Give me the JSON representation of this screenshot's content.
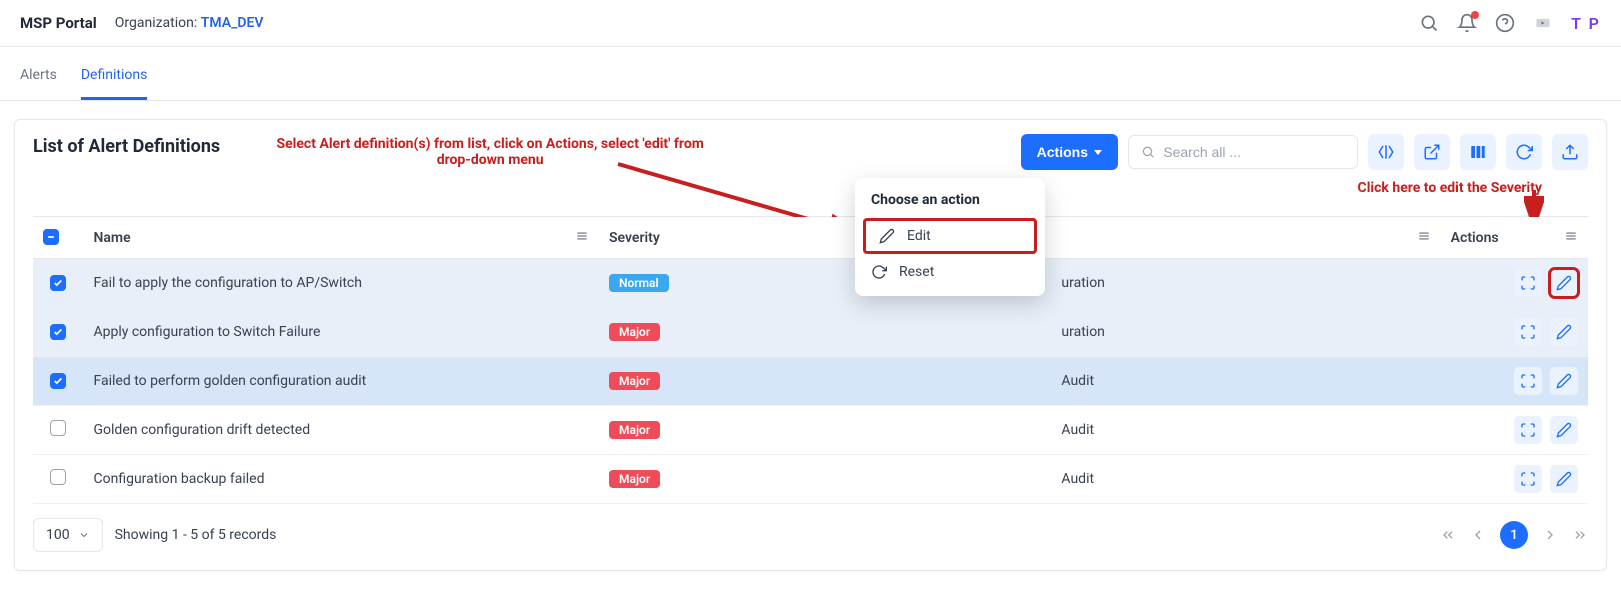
{
  "header": {
    "brand": "MSP Portal",
    "org_label": "Organization:",
    "org_name": "TMA_DEV",
    "avatar": "T P"
  },
  "tabs": [
    {
      "label": "Alerts",
      "active": false
    },
    {
      "label": "Definitions",
      "active": true
    }
  ],
  "page": {
    "title": "List of Alert Definitions",
    "annotation1": "Select Alert definition(s) from list, click on Actions, select 'edit' from drop-down menu",
    "annotation2": "Click here to edit the Severity",
    "actions_btn": "Actions",
    "search_placeholder": "Search all ..."
  },
  "actions_menu": {
    "title": "Choose an action",
    "items": [
      {
        "label": "Edit",
        "icon": "pencil",
        "highlight": true
      },
      {
        "label": "Reset",
        "icon": "reset",
        "highlight": false
      }
    ]
  },
  "table": {
    "columns": {
      "name": "Name",
      "severity": "Severity",
      "actions": "Actions"
    },
    "hidden_col_value_suffix": "uration",
    "rows": [
      {
        "checked": true,
        "name": "Fail to apply the configuration to AP/Switch",
        "severity": "Normal",
        "sev_class": "normal",
        "category": "uration",
        "selected": true,
        "highlightEdit": true
      },
      {
        "checked": true,
        "name": "Apply configuration to Switch Failure",
        "severity": "Major",
        "sev_class": "major",
        "category": "uration",
        "selected": true,
        "highlightEdit": false
      },
      {
        "checked": true,
        "name": "Failed to perform golden configuration audit",
        "severity": "Major",
        "sev_class": "major",
        "category": "Audit",
        "selected": true,
        "active": true,
        "highlightEdit": false
      },
      {
        "checked": false,
        "name": "Golden configuration drift detected",
        "severity": "Major",
        "sev_class": "major",
        "category": "Audit",
        "selected": false,
        "highlightEdit": false
      },
      {
        "checked": false,
        "name": "Configuration backup failed",
        "severity": "Major",
        "sev_class": "major",
        "category": "Audit",
        "selected": false,
        "highlightEdit": false
      }
    ]
  },
  "footer": {
    "page_size": "100",
    "info": "Showing 1 - 5 of 5 records",
    "current_page": "1"
  },
  "colors": {
    "primary": "#1d6eff",
    "annotation": "#c81e1e",
    "badge_normal": "#3ba7ee",
    "badge_major": "#ee4c58"
  }
}
